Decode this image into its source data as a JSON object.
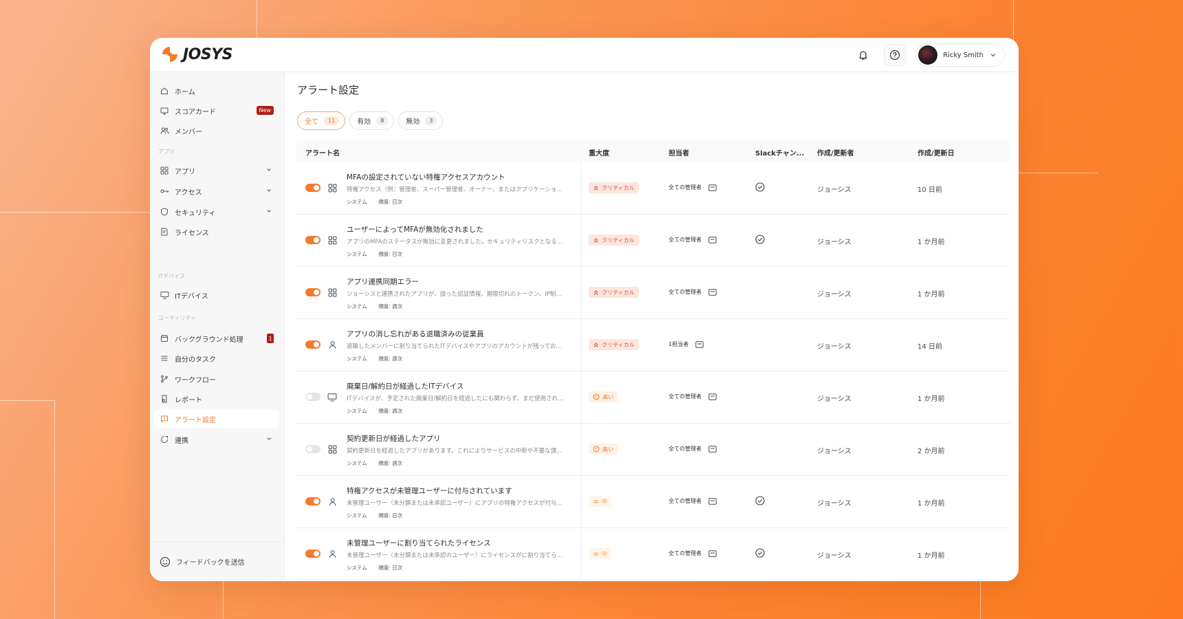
{
  "brand": {
    "name": "JOSYS",
    "accent": "#f47a2c",
    "badge_red": "#b01f17"
  },
  "header": {
    "notification_icon": "bell-icon",
    "help_icon": "help-circle-icon",
    "user_name": "Ricky Smith"
  },
  "sidebar": {
    "items": [
      {
        "label": "ホーム",
        "icon": "home-icon"
      },
      {
        "label": "スコアカード",
        "icon": "scorecard-icon",
        "badge": "New"
      },
      {
        "label": "メンバー",
        "icon": "members-icon"
      },
      {
        "label": "アプリ",
        "icon": "apps-icon"
      },
      {
        "label": "アクセス",
        "icon": "key-icon"
      },
      {
        "label": "セキュリティ",
        "icon": "shield-icon"
      },
      {
        "label": "ライセンス",
        "icon": "license-icon"
      },
      {
        "label": "ITデバイス",
        "icon": "monitor-icon"
      },
      {
        "label": "バックグラウンド処理",
        "icon": "calendar-icon",
        "badge": "1"
      },
      {
        "label": "自分のタスク",
        "icon": "list-icon"
      },
      {
        "label": "ワークフロー",
        "icon": "workflow-icon"
      },
      {
        "label": "レポート",
        "icon": "report-icon"
      },
      {
        "label": "アラート設定",
        "icon": "alert-icon",
        "active": true
      },
      {
        "label": "連携",
        "icon": "integration-icon"
      }
    ],
    "sections": {
      "apps": "アプリ",
      "devices": "ITデバイス",
      "utility": "ユーティリティ"
    },
    "feedback_label": "フィードバックを送信"
  },
  "main": {
    "title": "アラート設定",
    "tabs": [
      {
        "label": "全て",
        "count": "11",
        "active": true
      },
      {
        "label": "有効",
        "count": "8"
      },
      {
        "label": "無効",
        "count": "3"
      }
    ],
    "columns": [
      "アラート名",
      "重大度",
      "担当者",
      "Slackチャン...",
      "作成/更新者",
      "作成/更新日"
    ],
    "rows": [
      {
        "enabled": true,
        "type_icon": "apps-icon",
        "title": "MFAの設定されていない特権アクセスアカウント",
        "desc": "特権アクセス（例：管理者、スーパー管理者、オーナー、またはアプリケーショ...",
        "source": "システム",
        "frequency": "頻度: 日次",
        "severity": "クリティカル",
        "severity_level": "critical",
        "owner": "全ての管理者",
        "slack": true,
        "author": "ジョーシス",
        "date": "10 日前"
      },
      {
        "enabled": true,
        "type_icon": "apps-icon",
        "title": "ユーザーによってMFAが無効化されました",
        "desc": "アプリのMFAのステータスが無効に変更されました。セキュリティリスクとなる...",
        "source": "システム",
        "frequency": "頻度: 日次",
        "severity": "クリティカル",
        "severity_level": "critical",
        "owner": "全ての管理者",
        "slack": true,
        "author": "ジョーシス",
        "date": "1 か月前"
      },
      {
        "enabled": true,
        "type_icon": "apps-icon",
        "title": "アプリ連携同期エラー",
        "desc": "ジョーシスと連携されたアプリが、誤った認証情報、期限切れのトークン、IP制...",
        "source": "システム",
        "frequency": "頻度: 週次",
        "severity": "クリティカル",
        "severity_level": "critical",
        "owner": "全ての管理者",
        "slack": false,
        "author": "ジョーシス",
        "date": "1 か月前"
      },
      {
        "enabled": true,
        "type_icon": "user-icon",
        "title": "アプリの消し忘れがある退職済みの従業員",
        "desc": "退職したメンバーに割り当てられたITデバイスやアプリのアカウントが残ってお...",
        "source": "システム",
        "frequency": "頻度: 週次",
        "severity": "クリティカル",
        "severity_level": "critical",
        "owner": "1担当者",
        "slack": false,
        "author": "ジョーシス",
        "date": "14 日前"
      },
      {
        "enabled": false,
        "type_icon": "monitor-icon",
        "title": "廃棄日/解約日が経過したITデバイス",
        "desc": "ITデバイスが、予定された廃棄日/解約日を経過したにも関わらず、まだ使用され...",
        "source": "システム",
        "frequency": "頻度: 週次",
        "severity": "高い",
        "severity_level": "high",
        "owner": "全ての管理者",
        "slack": false,
        "author": "ジョーシス",
        "date": "1 か月前"
      },
      {
        "enabled": false,
        "type_icon": "apps-icon",
        "title": "契約更新日が経過したアプリ",
        "desc": "契約更新日を経過したアプリがあります。これによりサービスの中断や不要な課...",
        "source": "システム",
        "frequency": "頻度: 週次",
        "severity": "高い",
        "severity_level": "high",
        "owner": "全ての管理者",
        "slack": false,
        "author": "ジョーシス",
        "date": "2 か月前"
      },
      {
        "enabled": true,
        "type_icon": "user-icon",
        "title": "特権アクセスが未管理ユーザーに付与されています",
        "desc": "未管理ユーザー（未分類または未承認ユーザー）にアプリの特権アクセスが付与...",
        "source": "システム",
        "frequency": "頻度: 日次",
        "severity": "中",
        "severity_level": "medium",
        "owner": "全ての管理者",
        "slack": true,
        "author": "ジョーシス",
        "date": "1 か月前"
      },
      {
        "enabled": true,
        "type_icon": "user-icon",
        "title": "未管理ユーザーに割り当てられたライセンス",
        "desc": "未管理ユーザー（未分類または未承認のユーザー）にライセンスがに割り当てら...",
        "source": "システム",
        "frequency": "頻度: 日次",
        "severity": "中",
        "severity_level": "medium",
        "owner": "全ての管理者",
        "slack": true,
        "author": "ジョーシス",
        "date": "1 か月前"
      }
    ]
  }
}
